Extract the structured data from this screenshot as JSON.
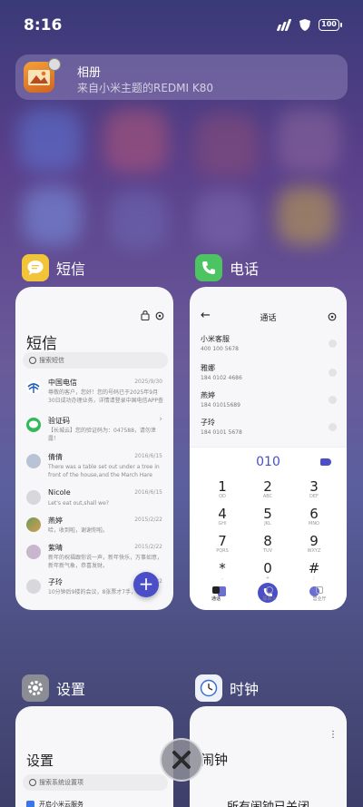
{
  "status_bar": {
    "time": "8:16",
    "battery": "100"
  },
  "notification": {
    "title": "相册",
    "subtitle": "来自小米主题的REDMI K80"
  },
  "apps": {
    "sms": {
      "name": "短信",
      "title": "短信",
      "search_placeholder": "搜索短信",
      "items": [
        {
          "name": "中国电信",
          "date": "2025/9/30",
          "text": "尊敬的客户，您好！您的号码已于2025年9月30日成功办理业务，详情请登录中国电信APP查询。"
        },
        {
          "name": "验证码",
          "date": "",
          "text": "【长城云】您的验证码为：047588，请勿泄露！"
        },
        {
          "name": "倩倩",
          "date": "2016/6/15",
          "text": "There was a table set out under a tree in front of the house,and the March Hare and..."
        },
        {
          "name": "Nicole",
          "date": "2016/6/15",
          "text": "Let's eat out,shall we?"
        },
        {
          "name": "燕婷",
          "date": "2015/2/22",
          "text": "哈，收到啦，谢谢你啦。"
        },
        {
          "name": "紫晴",
          "date": "2015/2/22",
          "text": "新年的祝福跟你说一声，新年快乐，万事如意，新年新气象，恭喜发财。"
        },
        {
          "name": "子玲",
          "date": "2015/2/22",
          "text": "10分钟后9楼的会议，8张票才7手，2张..."
        }
      ],
      "fab": "+"
    },
    "phone": {
      "name": "电话",
      "title": "通话",
      "contacts": [
        {
          "name": "小米客服",
          "number": "400 100 5678"
        },
        {
          "name": "雅娜",
          "number": "184 0102 4686"
        },
        {
          "name": "燕婷",
          "number": "184 01015689"
        },
        {
          "name": "子玲",
          "number": "184 0101 5678"
        }
      ],
      "dial_number": "010",
      "keys": [
        {
          "d": "1",
          "l": "QD"
        },
        {
          "d": "2",
          "l": "ABC"
        },
        {
          "d": "3",
          "l": "DEF"
        },
        {
          "d": "4",
          "l": "GHI"
        },
        {
          "d": "5",
          "l": "JKL"
        },
        {
          "d": "6",
          "l": "MNO"
        },
        {
          "d": "7",
          "l": "PQRS"
        },
        {
          "d": "8",
          "l": "TUV"
        },
        {
          "d": "9",
          "l": "WXYZ"
        },
        {
          "d": "*",
          "l": ","
        },
        {
          "d": "0",
          "l": "+"
        },
        {
          "d": "#",
          "l": ";"
        }
      ],
      "tabs": [
        "通话",
        "联系人",
        "营业厅"
      ]
    },
    "settings": {
      "name": "设置",
      "title": "设置",
      "search_placeholder": "搜索系统设置项",
      "first_item": "开启小米云服务"
    },
    "clock": {
      "name": "时钟",
      "title": "闹钟",
      "message": "所有闹钟已关闭"
    }
  }
}
